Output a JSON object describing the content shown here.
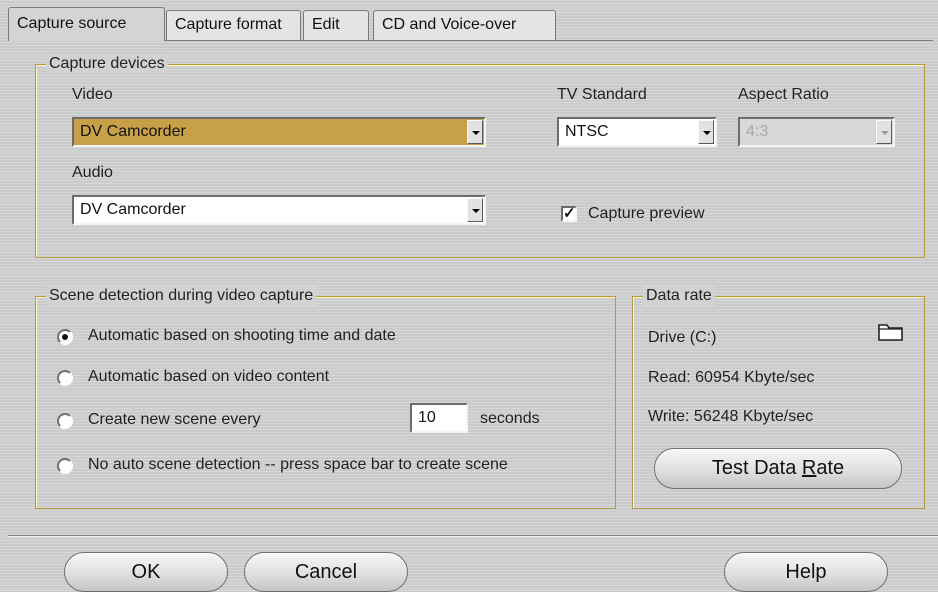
{
  "tabs": [
    {
      "label": "Capture source"
    },
    {
      "label": "Capture format"
    },
    {
      "label": "Edit"
    },
    {
      "label": "CD and Voice-over"
    }
  ],
  "capture_devices": {
    "title": "Capture devices",
    "video_label": "Video",
    "video_value": "DV Camcorder",
    "audio_label": "Audio",
    "audio_value": "DV Camcorder",
    "tv_standard_label": "TV Standard",
    "tv_standard_value": "NTSC",
    "aspect_ratio_label": "Aspect Ratio",
    "aspect_ratio_value": "4:3",
    "capture_preview_label": "Capture preview",
    "capture_preview_checked": true
  },
  "scene_detection": {
    "title": "Scene detection during video capture",
    "options": [
      {
        "label": "Automatic based on shooting time and date",
        "checked": true
      },
      {
        "label": "Automatic based on video content",
        "checked": false
      },
      {
        "label": "Create new scene every",
        "checked": false
      },
      {
        "label": "No auto scene detection -- press space bar to create scene",
        "checked": false
      }
    ],
    "interval_value": "10",
    "interval_unit": "seconds"
  },
  "data_rate": {
    "title": "Data rate",
    "drive": "Drive (C:)",
    "read": "Read: 60954 Kbyte/sec",
    "write": "Write: 56248 Kbyte/sec",
    "test_button_prefix": "Test Data ",
    "test_button_accel": "R",
    "test_button_suffix": "ate"
  },
  "footer": {
    "ok_label": "OK",
    "cancel_label": "Cancel",
    "help_label": "Help"
  },
  "colors": {
    "group_border": "#b39a3a",
    "video_combo_highlight": "#c8a048"
  },
  "icons": {
    "folder": "folder-icon"
  }
}
